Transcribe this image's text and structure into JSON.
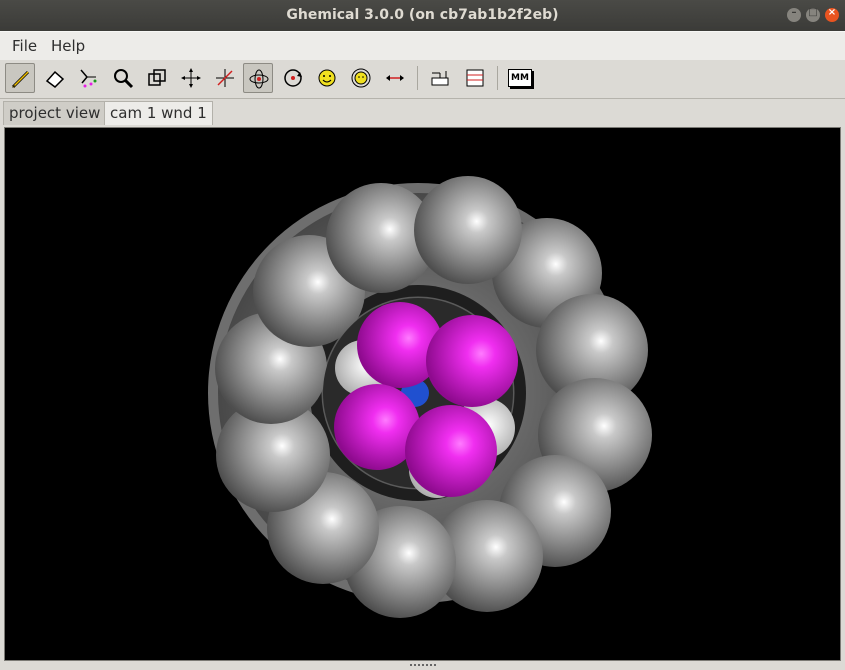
{
  "window": {
    "title": "Ghemical 3.0.0 (on cb7ab1b2f2eb)"
  },
  "window_controls": {
    "minimize": "–",
    "maximize": "□",
    "close": "×"
  },
  "menu": {
    "file": "File",
    "help": "Help"
  },
  "toolbar": {
    "tools": [
      "draw",
      "erase",
      "select",
      "zoom",
      "clipping",
      "translate-xy",
      "translate-z",
      "orbit-xy",
      "orbit-z",
      "rotate-xy",
      "rotate-z",
      "measure",
      "element",
      "bondtype",
      "mm"
    ],
    "active_tool": "orbit-xy",
    "mm_label": "MM"
  },
  "tabs": {
    "project_view": "project view",
    "cam_window": "cam 1 wnd 1",
    "active": "cam 1 wnd 1"
  },
  "colors": {
    "carbon": "#8c8c8c",
    "hydrogen_like": "#ffffff",
    "magenta_atom": "#e61ee6",
    "nitrogen": "#2050d0",
    "viewport_bg": "#000000"
  }
}
